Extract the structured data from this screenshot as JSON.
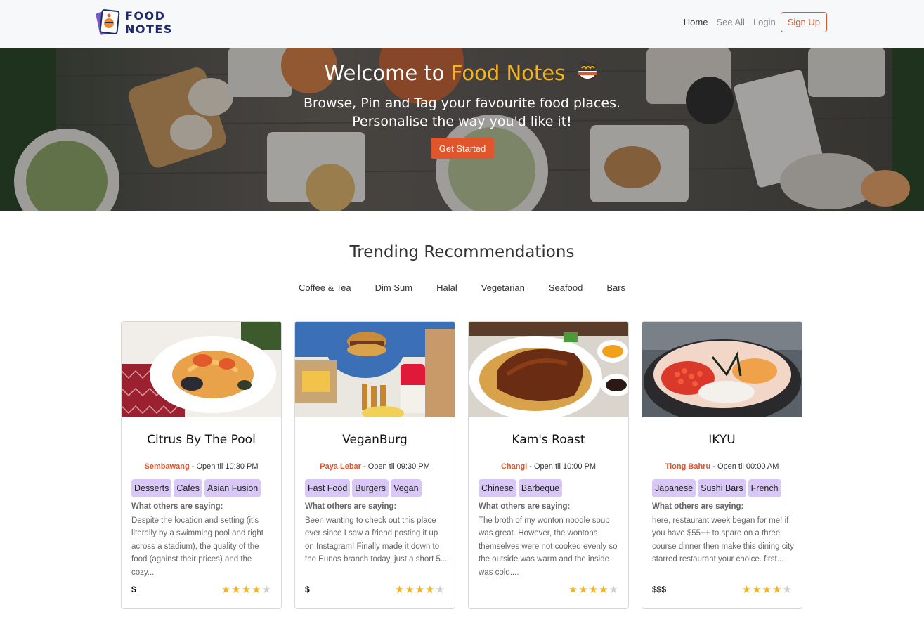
{
  "brand": {
    "line1": "FOOD",
    "line2": "NOTES"
  },
  "nav": {
    "home": "Home",
    "see_all": "See All",
    "login": "Login",
    "signup": "Sign Up"
  },
  "hero": {
    "title_prefix": "Welcome to ",
    "title_accent": "Food Notes",
    "subtitle_1": "Browse, Pin and Tag your favourite food places.",
    "subtitle_2": "Personalise the way you'd like it!",
    "cta": "Get Started",
    "icon": "noodle-bowl-icon"
  },
  "section": {
    "title": "Trending Recommendations",
    "categories": [
      "Coffee & Tea",
      "Dim Sum",
      "Halal",
      "Vegetarian",
      "Seafood",
      "Bars"
    ]
  },
  "saying_heading": "What others are saying:",
  "colors": {
    "accent": "#e0552b",
    "gold": "#f5b320",
    "tag": "#d8c7f7",
    "brand": "#1e2a6b"
  },
  "cards": [
    {
      "name": "Citrus By The Pool",
      "location": "Sembawang",
      "hours": " - Open til 10:30 PM",
      "tags": [
        "Desserts",
        "Cafes",
        "Asian Fusion"
      ],
      "review": "Despite the location and setting (it's literally by a swimming pool and right across a stadium), the quality of the food (against their prices) and the cozy...",
      "price": "$",
      "rating": 4,
      "image": "seafood-pasta-photo"
    },
    {
      "name": "VeganBurg",
      "location": "Paya Lebar",
      "hours": " - Open til 09:30 PM",
      "tags": [
        "Fast Food",
        "Burgers",
        "Vegan"
      ],
      "review": "Been wanting to check out this place ever since I saw a friend posting it up on Instagram! Finally made it down to the Eunos branch today, just a short 5...",
      "price": "$",
      "rating": 4,
      "image": "vegan-burger-photo"
    },
    {
      "name": "Kam's Roast",
      "location": "Changi",
      "hours": " - Open til 10:00 PM",
      "tags": [
        "Chinese",
        "Barbeque"
      ],
      "review": "The broth of my wonton noodle soup was great. However, the wontons themselves were not cooked evenly so the outside was warm and the inside was cold....",
      "price": "",
      "rating": 4,
      "image": "roast-goose-photo"
    },
    {
      "name": "IKYU",
      "location": "Tiong Bahru",
      "hours": " - Open til 00:00 AM",
      "tags": [
        "Japanese",
        "Sushi Bars",
        "French"
      ],
      "review": "here, restaurant week began for me! if you have $55++ to spare on a three course dinner then make this dining city starred restaurant your choice. first...",
      "price": "$$$",
      "rating": 4,
      "image": "chirashi-bowl-photo"
    }
  ]
}
